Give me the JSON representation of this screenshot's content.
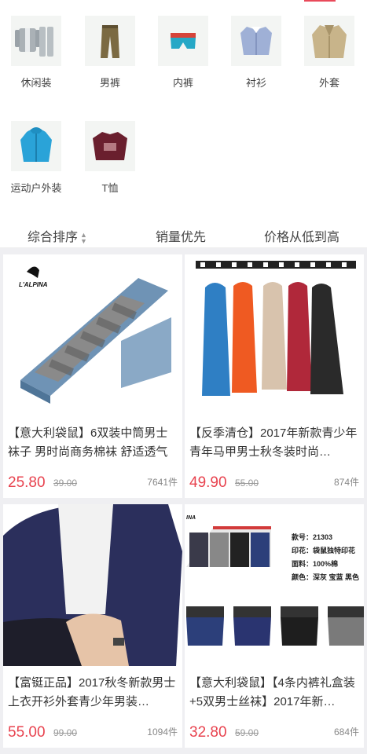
{
  "categories": [
    {
      "label": "休闲装",
      "icon": "casual-suit-icon"
    },
    {
      "label": "男裤",
      "icon": "pants-icon"
    },
    {
      "label": "内裤",
      "icon": "underwear-icon"
    },
    {
      "label": "衬衫",
      "icon": "shirt-icon"
    },
    {
      "label": "外套",
      "icon": "coat-icon"
    },
    {
      "label": "运动户外装",
      "icon": "sport-jacket-icon"
    },
    {
      "label": "T恤",
      "icon": "tshirt-icon"
    }
  ],
  "sort": {
    "comprehensive": "综合排序",
    "sales": "销量优先",
    "price_low_high": "价格从低到高"
  },
  "products": [
    {
      "title": "【意大利袋鼠】6双装中筒男士袜子 男时尚商务棉袜 舒适透气",
      "price": "25.80",
      "old_price": "39.00",
      "sold": "7641件",
      "brand": "L'ALPINA"
    },
    {
      "title": "【反季清仓】2017年新款青少年青年马甲男士秋冬装时尚…",
      "price": "49.90",
      "old_price": "55.00",
      "sold": "874件"
    },
    {
      "title": "【富铤正品】2017秋冬新款男士上衣开衫外套青少年男装…",
      "price": "55.00",
      "old_price": "99.00",
      "sold": "1094件"
    },
    {
      "title": "【意大利袋鼠】【4条内裤礼盒装+5双男士丝袜】2017年新…",
      "price": "32.80",
      "old_price": "59.00",
      "sold": "684件",
      "spec": {
        "code": "款号：21303",
        "print": "印花：袋鼠独特印花",
        "fabric": "面料：100%棉",
        "colors": "颜色：深灰 宝蓝 黑色"
      },
      "brand": "INA"
    }
  ],
  "colors": {
    "accent": "#e8434f",
    "bg": "#efeff2"
  }
}
